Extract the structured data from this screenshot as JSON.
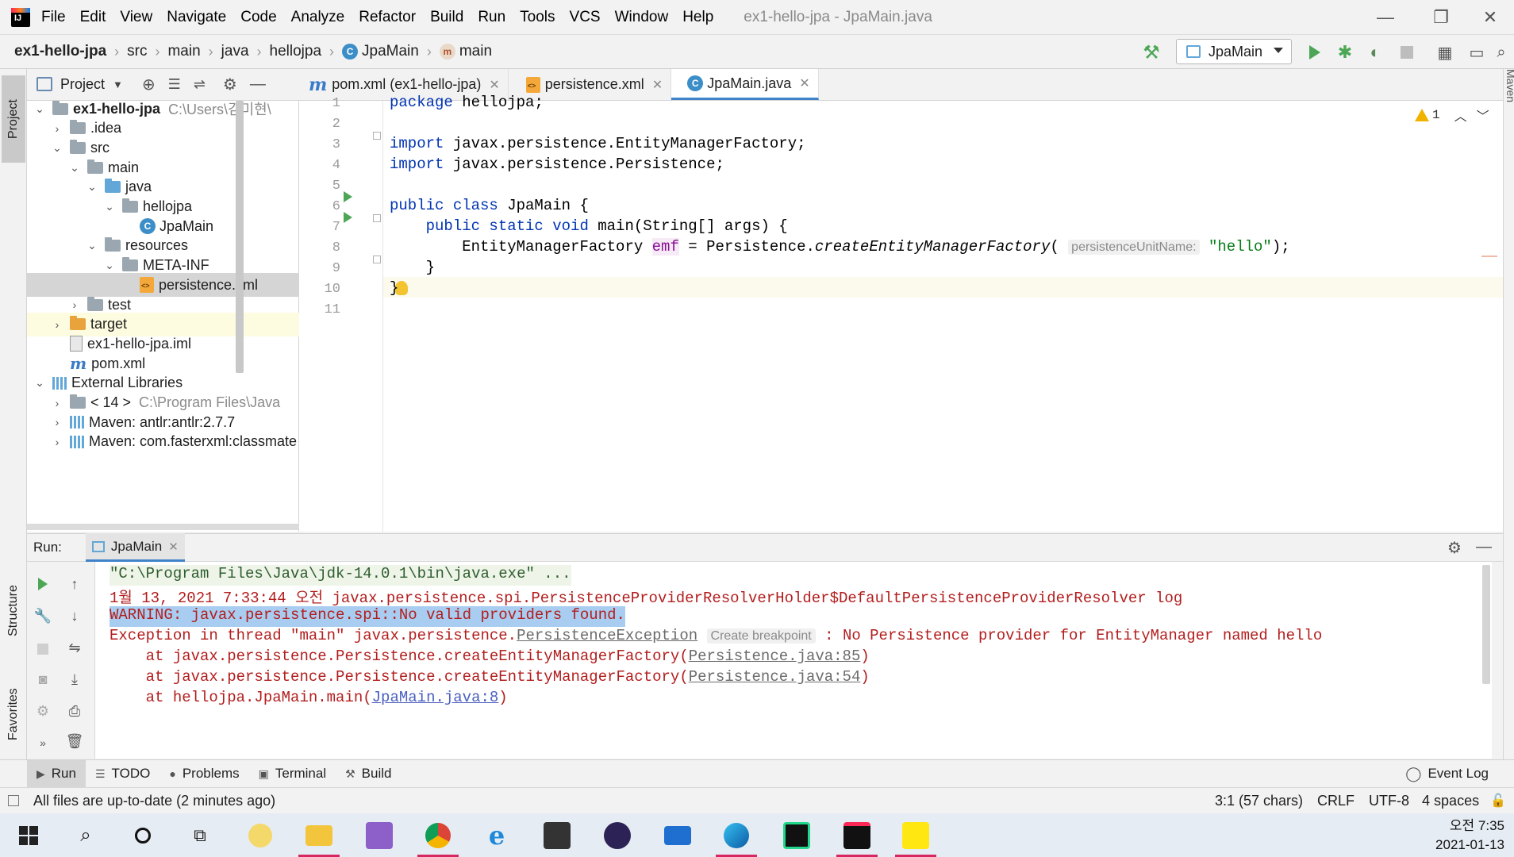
{
  "window": {
    "title": "ex1-hello-jpa - JpaMain.java",
    "menu": [
      "File",
      "Edit",
      "View",
      "Navigate",
      "Code",
      "Analyze",
      "Refactor",
      "Build",
      "Run",
      "Tools",
      "VCS",
      "Window",
      "Help"
    ]
  },
  "breadcrumb": [
    "ex1-hello-jpa",
    "src",
    "main",
    "java",
    "hellojpa",
    "JpaMain",
    "main"
  ],
  "toolbar": {
    "run_config": "JpaMain"
  },
  "left_strip": {
    "project": "Project",
    "structure": "Structure",
    "favorites": "Favorites"
  },
  "right_strip": {
    "maven": "Maven"
  },
  "project_panel": {
    "title": "Project",
    "tree": [
      {
        "label": "ex1-hello-jpa",
        "extra": "C:\\Users\\김미현\\",
        "indent": 0,
        "chevron": "open",
        "icon": "module",
        "bold": true
      },
      {
        "label": ".idea",
        "indent": 1,
        "chevron": "closed",
        "icon": "folder"
      },
      {
        "label": "src",
        "indent": 1,
        "chevron": "open",
        "icon": "folder"
      },
      {
        "label": "main",
        "indent": 2,
        "chevron": "open",
        "icon": "folder"
      },
      {
        "label": "java",
        "indent": 3,
        "chevron": "open",
        "icon": "folder-blue"
      },
      {
        "label": "hellojpa",
        "indent": 4,
        "chevron": "open",
        "icon": "package"
      },
      {
        "label": "JpaMain",
        "indent": 5,
        "chevron": "none",
        "icon": "class"
      },
      {
        "label": "resources",
        "indent": 3,
        "chevron": "open",
        "icon": "folder-res"
      },
      {
        "label": "META-INF",
        "indent": 4,
        "chevron": "open",
        "icon": "folder"
      },
      {
        "label": "persistence.xml",
        "indent": 5,
        "chevron": "none",
        "icon": "xml",
        "selected": true
      },
      {
        "label": "test",
        "indent": 2,
        "chevron": "closed",
        "icon": "folder"
      },
      {
        "label": "target",
        "indent": 1,
        "chevron": "closed",
        "icon": "folder-orange",
        "hilite": true
      },
      {
        "label": "ex1-hello-jpa.iml",
        "indent": 1,
        "chevron": "none",
        "icon": "iml"
      },
      {
        "label": "pom.xml",
        "indent": 1,
        "chevron": "none",
        "icon": "maven"
      },
      {
        "label": "External Libraries",
        "indent": 0,
        "chevron": "open",
        "icon": "lib"
      },
      {
        "label": "< 14 >",
        "extra": "C:\\Program Files\\Java",
        "indent": 1,
        "chevron": "closed",
        "icon": "lib-folder"
      },
      {
        "label": "Maven: antlr:antlr:2.7.7",
        "indent": 1,
        "chevron": "closed",
        "icon": "lib"
      },
      {
        "label": "Maven: com.fasterxml:classmate",
        "indent": 1,
        "chevron": "closed",
        "icon": "lib"
      }
    ]
  },
  "editor_tabs": [
    {
      "label": "pom.xml (ex1-hello-jpa)",
      "icon": "maven",
      "active": false
    },
    {
      "label": "persistence.xml",
      "icon": "xml",
      "active": false
    },
    {
      "label": "JpaMain.java",
      "icon": "class",
      "active": true
    }
  ],
  "editor": {
    "warning_count": "1",
    "line_numbers": [
      "1",
      "2",
      "3",
      "4",
      "5",
      "6",
      "7",
      "8",
      "9",
      "10",
      "11"
    ],
    "l1_kw": "package",
    "l1_rest": " hellojpa;",
    "l3_kw": "import",
    "l3_rest": " javax.persistence.EntityManagerFactory;",
    "l4_kw": "import",
    "l4_rest": " javax.persistence.Persistence;",
    "l6_kw": "public class",
    "l6_rest": " JpaMain {",
    "l7_kw": "    public static void",
    "l7_rest": " main(String[] args) {",
    "l8_type": "        EntityManagerFactory ",
    "l8_var": "emf",
    "l8_mid": " = Persistence.",
    "l8_method": "createEntityManagerFactory",
    "l8_open": "( ",
    "l8_hint": "persistenceUnitName:",
    "l8_str": "\"hello\"",
    "l8_close": ");",
    "l9": "    }",
    "l10": "}"
  },
  "run_panel": {
    "label": "Run:",
    "tab": "JpaMain",
    "console": {
      "line1": "\"C:\\Program Files\\Java\\jdk-14.0.1\\bin\\java.exe\" ...",
      "line2": "1월 13, 2021 7:33:44 오전 javax.persistence.spi.PersistenceProviderResolverHolder$DefaultPersistenceProviderResolver log",
      "line3": "WARNING: javax.persistence.spi::No valid providers found.",
      "line4_a": "Exception in thread \"main\" javax.persistence.",
      "line4_link": "PersistenceException",
      "line4_hint": "Create breakpoint",
      "line4_b": " : No Persistence provider for EntityManager named hello",
      "line5_a": "    at javax.persistence.Persistence.createEntityManagerFactory(",
      "line5_link": "Persistence.java:85",
      "line5_b": ")",
      "line6_a": "    at javax.persistence.Persistence.createEntityManagerFactory(",
      "line6_link": "Persistence.java:54",
      "line6_b": ")",
      "line7_a": "    at hellojpa.JpaMain.main(",
      "line7_link": "JpaMain.java:8",
      "line7_b": ")"
    }
  },
  "bottom_tabs": [
    {
      "label": "Run",
      "icon": "▶",
      "active": true
    },
    {
      "label": "TODO",
      "icon": "☰",
      "active": false
    },
    {
      "label": "Problems",
      "icon": "●",
      "active": false
    },
    {
      "label": "Terminal",
      "icon": "▣",
      "active": false
    },
    {
      "label": "Build",
      "icon": "⚒",
      "active": false
    }
  ],
  "event_log": "Event Log",
  "status": {
    "message": "All files are up-to-date (2 minutes ago)",
    "position": "3:1 (57 chars)",
    "line_sep": "CRLF",
    "encoding": "UTF-8",
    "indent": "4 spaces"
  },
  "taskbar": {
    "time": "오전 7:35",
    "date": "2021-01-13",
    "apps": [
      "start",
      "search",
      "cortana",
      "task-view",
      "kakao-pet",
      "file-explorer",
      "visual-studio",
      "chrome",
      "internet-explorer",
      "store",
      "eclipse",
      "mail",
      "edge",
      "pycharm",
      "intellij",
      "kakaotalk"
    ]
  },
  "colors": {
    "accent": "#4083c9",
    "keyword": "#0033b3",
    "string": "#067d17",
    "error": "#b31d1d",
    "run_green": "#4ca656"
  }
}
